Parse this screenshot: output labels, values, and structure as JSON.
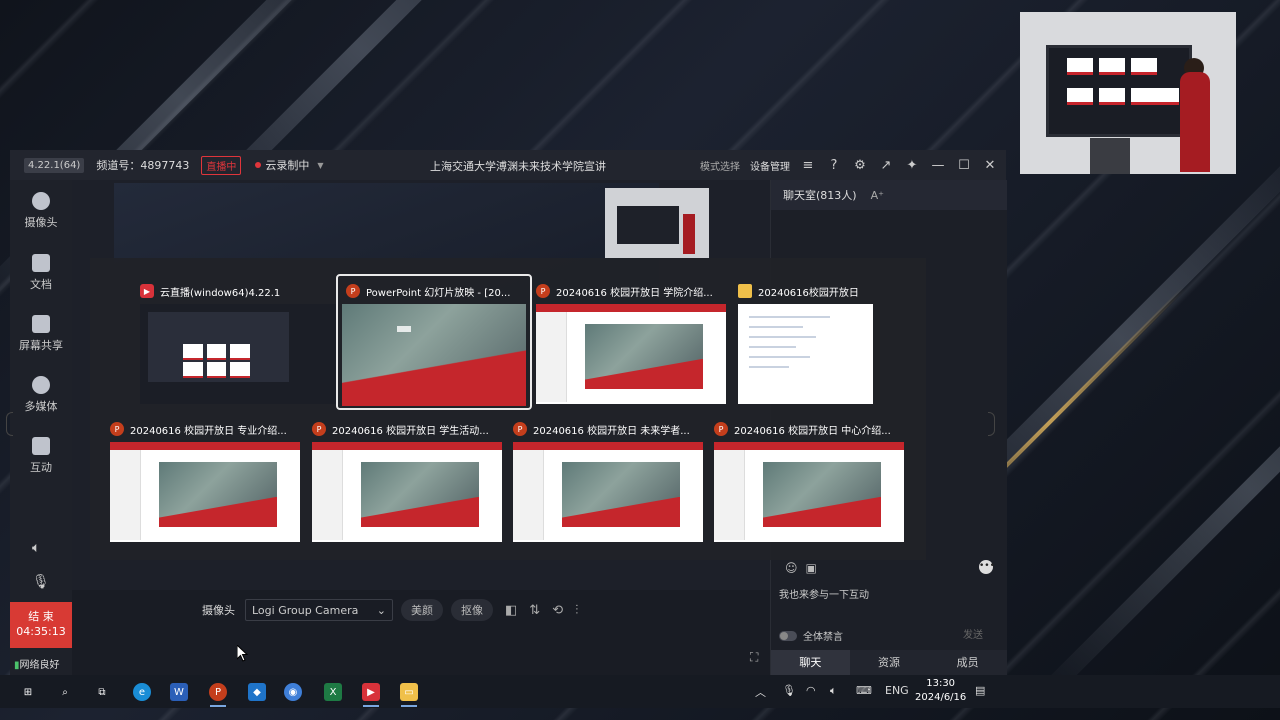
{
  "titlebar": {
    "version": "4.22.1(64)",
    "channel": "频道号：4897743",
    "live_badge": "直播中",
    "cloud_record": "云录制中",
    "window_title": "上海交通大学溥渊未来技术学院宣讲",
    "mode_select": "模式选择",
    "device_manage": "设备管理"
  },
  "sidebar": {
    "items": [
      {
        "label": "摄像头",
        "icon": "camera-icon"
      },
      {
        "label": "文档",
        "icon": "document-icon"
      },
      {
        "label": "屏幕共享",
        "icon": "screen-share-icon"
      },
      {
        "label": "多媒体",
        "icon": "multimedia-icon"
      },
      {
        "label": "互动",
        "icon": "interact-icon"
      }
    ],
    "end_label": "结 束",
    "end_time": "04:35:13",
    "network": "网络良好"
  },
  "controls": {
    "camera_label": "摄像头",
    "camera_value": "Logi Group Camera",
    "beauty": "美颜",
    "matting": "抠像"
  },
  "chat": {
    "title": "聊天室(813人)",
    "font_size": "A⁺",
    "input_placeholder": "我也来参与一下互动",
    "mute_all": "全体禁言",
    "send": "发送",
    "tabs": [
      "聊天",
      "资源",
      "成员"
    ]
  },
  "switcher": {
    "tiles": [
      {
        "title": "云直播(window64)4.22.1",
        "app": "live"
      },
      {
        "title": "PowerPoint 幻灯片放映 - [20...",
        "app": "ppt",
        "selected": true
      },
      {
        "title": "20240616 校园开放日 学院介绍...",
        "app": "ppt"
      },
      {
        "title": "20240616校园开放日",
        "app": "folder"
      },
      {
        "title": "20240616 校园开放日 专业介绍...",
        "app": "ppt"
      },
      {
        "title": "20240616 校园开放日 学生活动...",
        "app": "ppt"
      },
      {
        "title": "20240616 校园开放日 未来学者...",
        "app": "ppt"
      },
      {
        "title": "20240616 校园开放日 中心介绍...",
        "app": "ppt"
      }
    ]
  },
  "taskbar": {
    "lang": "ENG",
    "time": "13:30",
    "date": "2024/6/16"
  },
  "colors": {
    "accent_red": "#d83a34",
    "ppt_red": "#c5262c",
    "app_bg": "#191c24"
  }
}
